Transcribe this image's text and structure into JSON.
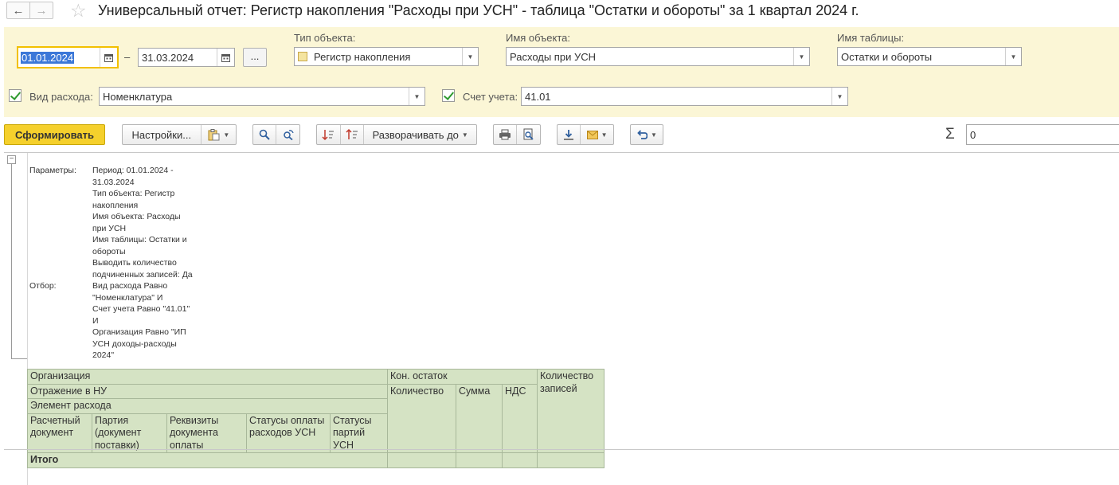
{
  "window": {
    "title": "Универсальный отчет: Регистр накопления \"Расходы при УСН\" - таблица \"Остатки и обороты\" за 1 квартал 2024 г.",
    "back_icon": "←",
    "forward_icon": "→",
    "star_icon": "☆"
  },
  "filters": {
    "date_from": "01.01.2024",
    "date_to": "31.03.2024",
    "dash": "–",
    "dots_label": "...",
    "object_type_label": "Тип объекта:",
    "object_type_value": "Регистр накопления",
    "object_name_label": "Имя объекта:",
    "object_name_value": "Расходы при УСН",
    "table_name_label": "Имя таблицы:",
    "table_name_value": "Остатки и обороты",
    "expense_kind_label": "Вид расхода:",
    "expense_kind_value": "Номенклатура",
    "account_label": "Счет учета:",
    "account_value": "41.01"
  },
  "toolbar": {
    "generate_label": "Сформировать",
    "settings_label": "Настройки...",
    "expand_label": "Разворачивать до",
    "sum_value": "0",
    "sigma": "Σ"
  },
  "report": {
    "params_key": "Параметры:",
    "params_lines": [
      "Период: 01.01.2024 -",
      "31.03.2024",
      "Тип объекта: Регистр",
      "накопления",
      "Имя объекта: Расходы",
      "при УСН",
      "Имя таблицы: Остатки и",
      "обороты",
      "Выводить количество",
      "подчиненных записей: Да"
    ],
    "filter_key": "Отбор:",
    "filter_lines": [
      "Вид расхода Равно",
      "\"Номенклатура\" И",
      "Счет учета Равно \"41.01\"",
      "И",
      "Организация Равно \"ИП",
      "УСН доходы-расходы",
      "2024\""
    ],
    "table": {
      "h_org": "Организация",
      "h_nu": "Отражение в НУ",
      "h_element": "Элемент расхода",
      "h_calc_doc": "Расчетный документ",
      "h_party": "Партия (документ поставки)",
      "h_payment": "Реквизиты документа оплаты",
      "h_status_pay": "Статусы оплаты расходов УСН",
      "h_status_party": "Статусы партий УСН",
      "h_end_balance": "Кон. остаток",
      "h_qty": "Количество",
      "h_sum": "Сумма",
      "h_vat": "НДС",
      "h_records": "Количество записей",
      "total_label": "Итого"
    }
  }
}
